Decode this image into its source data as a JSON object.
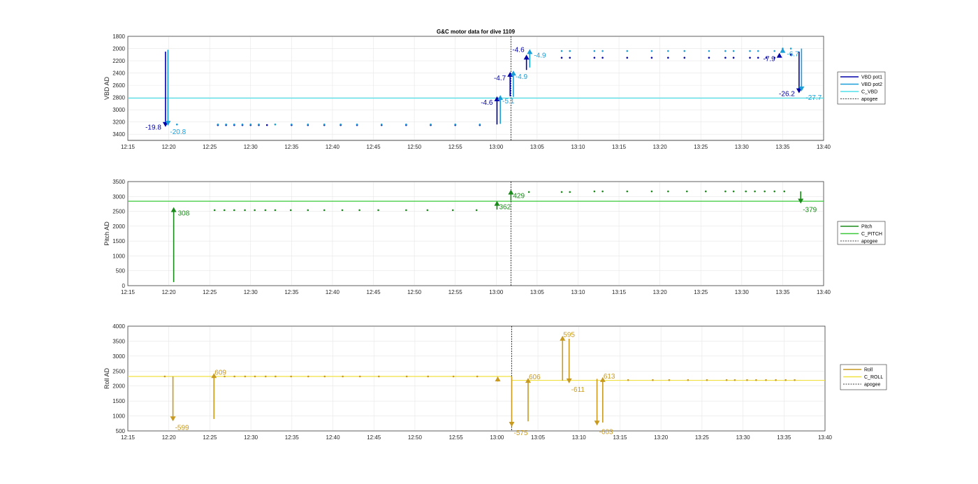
{
  "chart_data": [
    {
      "type": "line",
      "title": "G&C motor data for dive 1109",
      "ylabel": "VBD AD",
      "ylim": [
        1800,
        3500
      ],
      "y_reversed": true,
      "yticks": [
        "1800",
        "2000",
        "2200",
        "2400",
        "2600",
        "2800",
        "3000",
        "3200",
        "3400"
      ],
      "xticks": [
        "12:15",
        "12:20",
        "12:25",
        "12:30",
        "12:35",
        "12:40",
        "12:45",
        "12:50",
        "12:55",
        "13:00",
        "13:05",
        "13:10",
        "13:15",
        "13:20",
        "13:25",
        "13:30",
        "13:35",
        "13:40"
      ],
      "grid": true,
      "legend": {
        "placement": "right",
        "entries": [
          "VBD pot1",
          "VBD pot2",
          "C_VBD",
          "apogee"
        ]
      },
      "colors": {
        "pot1": "#0000a8",
        "pot2": "#1a9ed8",
        "c_line": "#4fe0e8",
        "apogee": "#000000"
      },
      "reference_line": {
        "name": "C_VBD",
        "y": 2810
      },
      "apogee_x": "13:01.8",
      "series": [
        {
          "name": "VBD pot1",
          "x": [
            "12:26",
            "12:27",
            "12:28",
            "12:29",
            "12:30",
            "12:31",
            "12:32",
            "12:35",
            "12:37",
            "12:39",
            "12:41",
            "12:43",
            "12:46",
            "12:49",
            "12:52",
            "12:55",
            "12:58",
            "13:08",
            "13:09",
            "13:12",
            "13:13",
            "13:16",
            "13:19",
            "13:21",
            "13:23",
            "13:26",
            "13:28",
            "13:29",
            "13:31",
            "13:32",
            "13:33",
            "13:34",
            "13:36"
          ],
          "y": [
            3250,
            3250,
            3250,
            3250,
            3250,
            3250,
            3250,
            3250,
            3250,
            3250,
            3250,
            3250,
            3250,
            3250,
            3250,
            3250,
            3250,
            2150,
            2150,
            2150,
            2150,
            2150,
            2150,
            2150,
            2150,
            2150,
            2150,
            2150,
            2150,
            2150,
            2150,
            2150,
            2100
          ]
        },
        {
          "name": "VBD pot2",
          "x": [
            "12:21",
            "12:26",
            "12:27",
            "12:28",
            "12:29",
            "12:30",
            "12:31",
            "12:33",
            "12:35",
            "12:37",
            "12:39",
            "12:41",
            "12:43",
            "12:46",
            "12:49",
            "12:52",
            "12:55",
            "12:58",
            "13:08",
            "13:09",
            "13:12",
            "13:13",
            "13:16",
            "13:19",
            "13:21",
            "13:23",
            "13:26",
            "13:28",
            "13:29",
            "13:31",
            "13:32",
            "13:34",
            "13:35",
            "13:36"
          ],
          "y": [
            3240,
            3240,
            3240,
            3240,
            3240,
            3240,
            3240,
            3240,
            3240,
            3240,
            3240,
            3240,
            3240,
            3240,
            3240,
            3240,
            3240,
            3240,
            2040,
            2040,
            2040,
            2040,
            2040,
            2040,
            2040,
            2040,
            2040,
            2040,
            2040,
            2040,
            2040,
            2040,
            2000,
            2000
          ]
        }
      ],
      "arrows": [
        {
          "x": "12:19.6",
          "from": 2050,
          "to": 3280,
          "color": "#0000a8",
          "label": "-19.8",
          "label_pos": "left"
        },
        {
          "x": "12:19.9",
          "from": 2020,
          "to": 3260,
          "color": "#1a9ed8",
          "label": "-20.8",
          "label_pos": "below-right"
        },
        {
          "x": "13:00.1",
          "from": 3240,
          "to": 2780,
          "color": "#0000a8",
          "label": "-4.6",
          "label_pos": "left"
        },
        {
          "x": "13:00.5",
          "from": 3230,
          "to": 2760,
          "color": "#1a9ed8",
          "label": "-5.1",
          "label_pos": "below-right"
        },
        {
          "x": "13:01.7",
          "from": 2780,
          "to": 2380,
          "color": "#0000a8",
          "label": "-4.7",
          "label_pos": "left"
        },
        {
          "x": "13:02.1",
          "from": 2790,
          "to": 2360,
          "color": "#1a9ed8",
          "label": "-4.9",
          "label_pos": "below-right"
        },
        {
          "x": "13:03.7",
          "from": 2350,
          "to": 2100,
          "color": "#0000a8",
          "label": "-4.6",
          "label_pos": "above-left"
        },
        {
          "x": "13:04.1",
          "from": 2310,
          "to": 2010,
          "color": "#1a9ed8",
          "label": "-4.9",
          "label_pos": "right"
        },
        {
          "x": "13:34.6",
          "from": 2120,
          "to": 2070,
          "color": "#0000a8",
          "label": "-7.9",
          "label_pos": "left"
        },
        {
          "x": "13:35.0",
          "from": 2050,
          "to": 1990,
          "color": "#1a9ed8",
          "label": "-6.7",
          "label_pos": "right"
        },
        {
          "x": "13:37.0",
          "from": 2050,
          "to": 2730,
          "color": "#0000a8",
          "label": "-26.2",
          "label_pos": "left"
        },
        {
          "x": "13:37.3",
          "from": 2000,
          "to": 2700,
          "color": "#1a9ed8",
          "label": "-27.7",
          "label_pos": "right"
        }
      ]
    },
    {
      "type": "line",
      "title": "",
      "ylabel": "Pitch AD",
      "ylim": [
        0,
        3500
      ],
      "yticks": [
        "0",
        "500",
        "1000",
        "1500",
        "2000",
        "2500",
        "3000",
        "3500"
      ],
      "xticks": [
        "12:15",
        "12:20",
        "12:25",
        "12:30",
        "12:35",
        "12:40",
        "12:45",
        "12:50",
        "12:55",
        "13:00",
        "13:05",
        "13:10",
        "13:15",
        "13:20",
        "13:25",
        "13:30",
        "13:35",
        "13:40"
      ],
      "grid": true,
      "legend": {
        "placement": "right",
        "entries": [
          "Pitch",
          "C_PITCH",
          "apogee"
        ]
      },
      "colors": {
        "pitch": "#1a8a1a",
        "c_line": "#3ac83a",
        "apogee": "#000000"
      },
      "reference_line": {
        "name": "C_PITCH",
        "y": 2840
      },
      "apogee_x": "13:01.8",
      "series": [
        {
          "name": "Pitch",
          "x": [
            "12:25.6",
            "12:26.8",
            "12:28",
            "12:29.3",
            "12:30.5",
            "12:31.8",
            "12:33",
            "12:34.9",
            "12:37",
            "12:39",
            "12:41.2",
            "12:43.3",
            "12:45.6",
            "12:49",
            "12:51.6",
            "12:54.7",
            "12:57.6",
            "13:04",
            "13:08",
            "13:09",
            "13:12",
            "13:13",
            "13:16",
            "13:19",
            "13:21",
            "13:23.3",
            "13:25.6",
            "13:28",
            "13:29",
            "13:30.5",
            "13:31.6",
            "13:32.8",
            "13:34",
            "13:35.2"
          ],
          "y": [
            2540,
            2540,
            2540,
            2540,
            2540,
            2540,
            2540,
            2540,
            2540,
            2540,
            2540,
            2540,
            2540,
            2540,
            2540,
            2540,
            2540,
            3150,
            3150,
            3150,
            3170,
            3170,
            3170,
            3170,
            3170,
            3170,
            3170,
            3170,
            3170,
            3170,
            3170,
            3170,
            3170,
            3170
          ]
        }
      ],
      "arrows": [
        {
          "x": "12:20.6",
          "from": 120,
          "to": 2640,
          "color": "#1a8a1a",
          "label": "308",
          "label_pos": "right"
        },
        {
          "x": "13:00.1",
          "from": 2560,
          "to": 2850,
          "color": "#1a8a1a",
          "label": "362",
          "label_pos": "below-right"
        },
        {
          "x": "13:01.8",
          "from": 2860,
          "to": 3230,
          "color": "#1a8a1a",
          "label": "429",
          "label_pos": "below-right"
        },
        {
          "x": "13:37.2",
          "from": 3170,
          "to": 2760,
          "color": "#1a8a1a",
          "label": "-379",
          "label_pos": "below-right"
        }
      ]
    },
    {
      "type": "line",
      "title": "",
      "ylabel": "Roll AD",
      "ylim": [
        500,
        4000
      ],
      "yticks": [
        "500",
        "1000",
        "1500",
        "2000",
        "2500",
        "3000",
        "3500",
        "4000"
      ],
      "xticks": [
        "12:15",
        "12:20",
        "12:25",
        "12:30",
        "12:35",
        "12:40",
        "12:45",
        "12:50",
        "12:55",
        "13:00",
        "13:05",
        "13:10",
        "13:15",
        "13:20",
        "13:25",
        "13:30",
        "13:35",
        "13:40"
      ],
      "grid": true,
      "legend": {
        "placement": "right",
        "entries": [
          "Roll",
          "C_ROLL",
          "apogee"
        ]
      },
      "colors": {
        "roll": "#c89a20",
        "c_line": "#f0e040",
        "apogee": "#000000"
      },
      "reference_line": {
        "name": "C_ROLL",
        "y_start": 2320,
        "y_end": 2190,
        "break_x": "13:01.8"
      },
      "apogee_x": "13:01.8",
      "series": [
        {
          "name": "Roll",
          "x": [
            "12:19.5",
            "12:26.8",
            "12:28",
            "12:29.3",
            "12:30.5",
            "12:31.8",
            "12:33",
            "12:34.9",
            "12:37",
            "12:39",
            "12:41.2",
            "12:43.3",
            "12:45.6",
            "12:49",
            "12:51.6",
            "12:54.7",
            "12:57.6",
            "13:16",
            "13:19",
            "13:21",
            "13:23.3",
            "13:25.6",
            "13:28",
            "13:29",
            "13:30.5",
            "13:31.6",
            "13:32.8",
            "13:34",
            "13:35.2",
            "13:36.3"
          ],
          "y": [
            2320,
            2320,
            2320,
            2320,
            2320,
            2320,
            2320,
            2320,
            2320,
            2320,
            2320,
            2320,
            2320,
            2320,
            2320,
            2320,
            2320,
            2200,
            2200,
            2200,
            2200,
            2200,
            2200,
            2200,
            2200,
            2200,
            2200,
            2200,
            2200,
            2200
          ]
        }
      ],
      "arrows": [
        {
          "x": "12:20.5",
          "from": 2320,
          "to": 820,
          "color": "#c89a20",
          "label": "-599",
          "label_pos": "below-right"
        },
        {
          "x": "12:25.5",
          "from": 900,
          "to": 2430,
          "color": "#c89a20",
          "label": "609",
          "label_pos": "right-top"
        },
        {
          "x": "13:00.1",
          "from": 2150,
          "to": 2320,
          "color": "#c89a20",
          "label": "",
          "label_pos": "none"
        },
        {
          "x": "13:01.8",
          "from": 2310,
          "to": 640,
          "color": "#c89a20",
          "label": "-575",
          "label_pos": "below-right"
        },
        {
          "x": "13:03.8",
          "from": 820,
          "to": 2270,
          "color": "#c89a20",
          "label": "606",
          "label_pos": "right-top"
        },
        {
          "x": "13:08.0",
          "from": 2180,
          "to": 3680,
          "color": "#c89a20",
          "label": "595",
          "label_pos": "right-top"
        },
        {
          "x": "13:08.8",
          "from": 3580,
          "to": 2090,
          "color": "#c89a20",
          "label": "-611",
          "label_pos": "below-right"
        },
        {
          "x": "13:12.2",
          "from": 2240,
          "to": 680,
          "color": "#c89a20",
          "label": "-603",
          "label_pos": "below-right"
        },
        {
          "x": "13:12.9",
          "from": 780,
          "to": 2300,
          "color": "#c89a20",
          "label": "613",
          "label_pos": "right-top"
        }
      ]
    }
  ]
}
